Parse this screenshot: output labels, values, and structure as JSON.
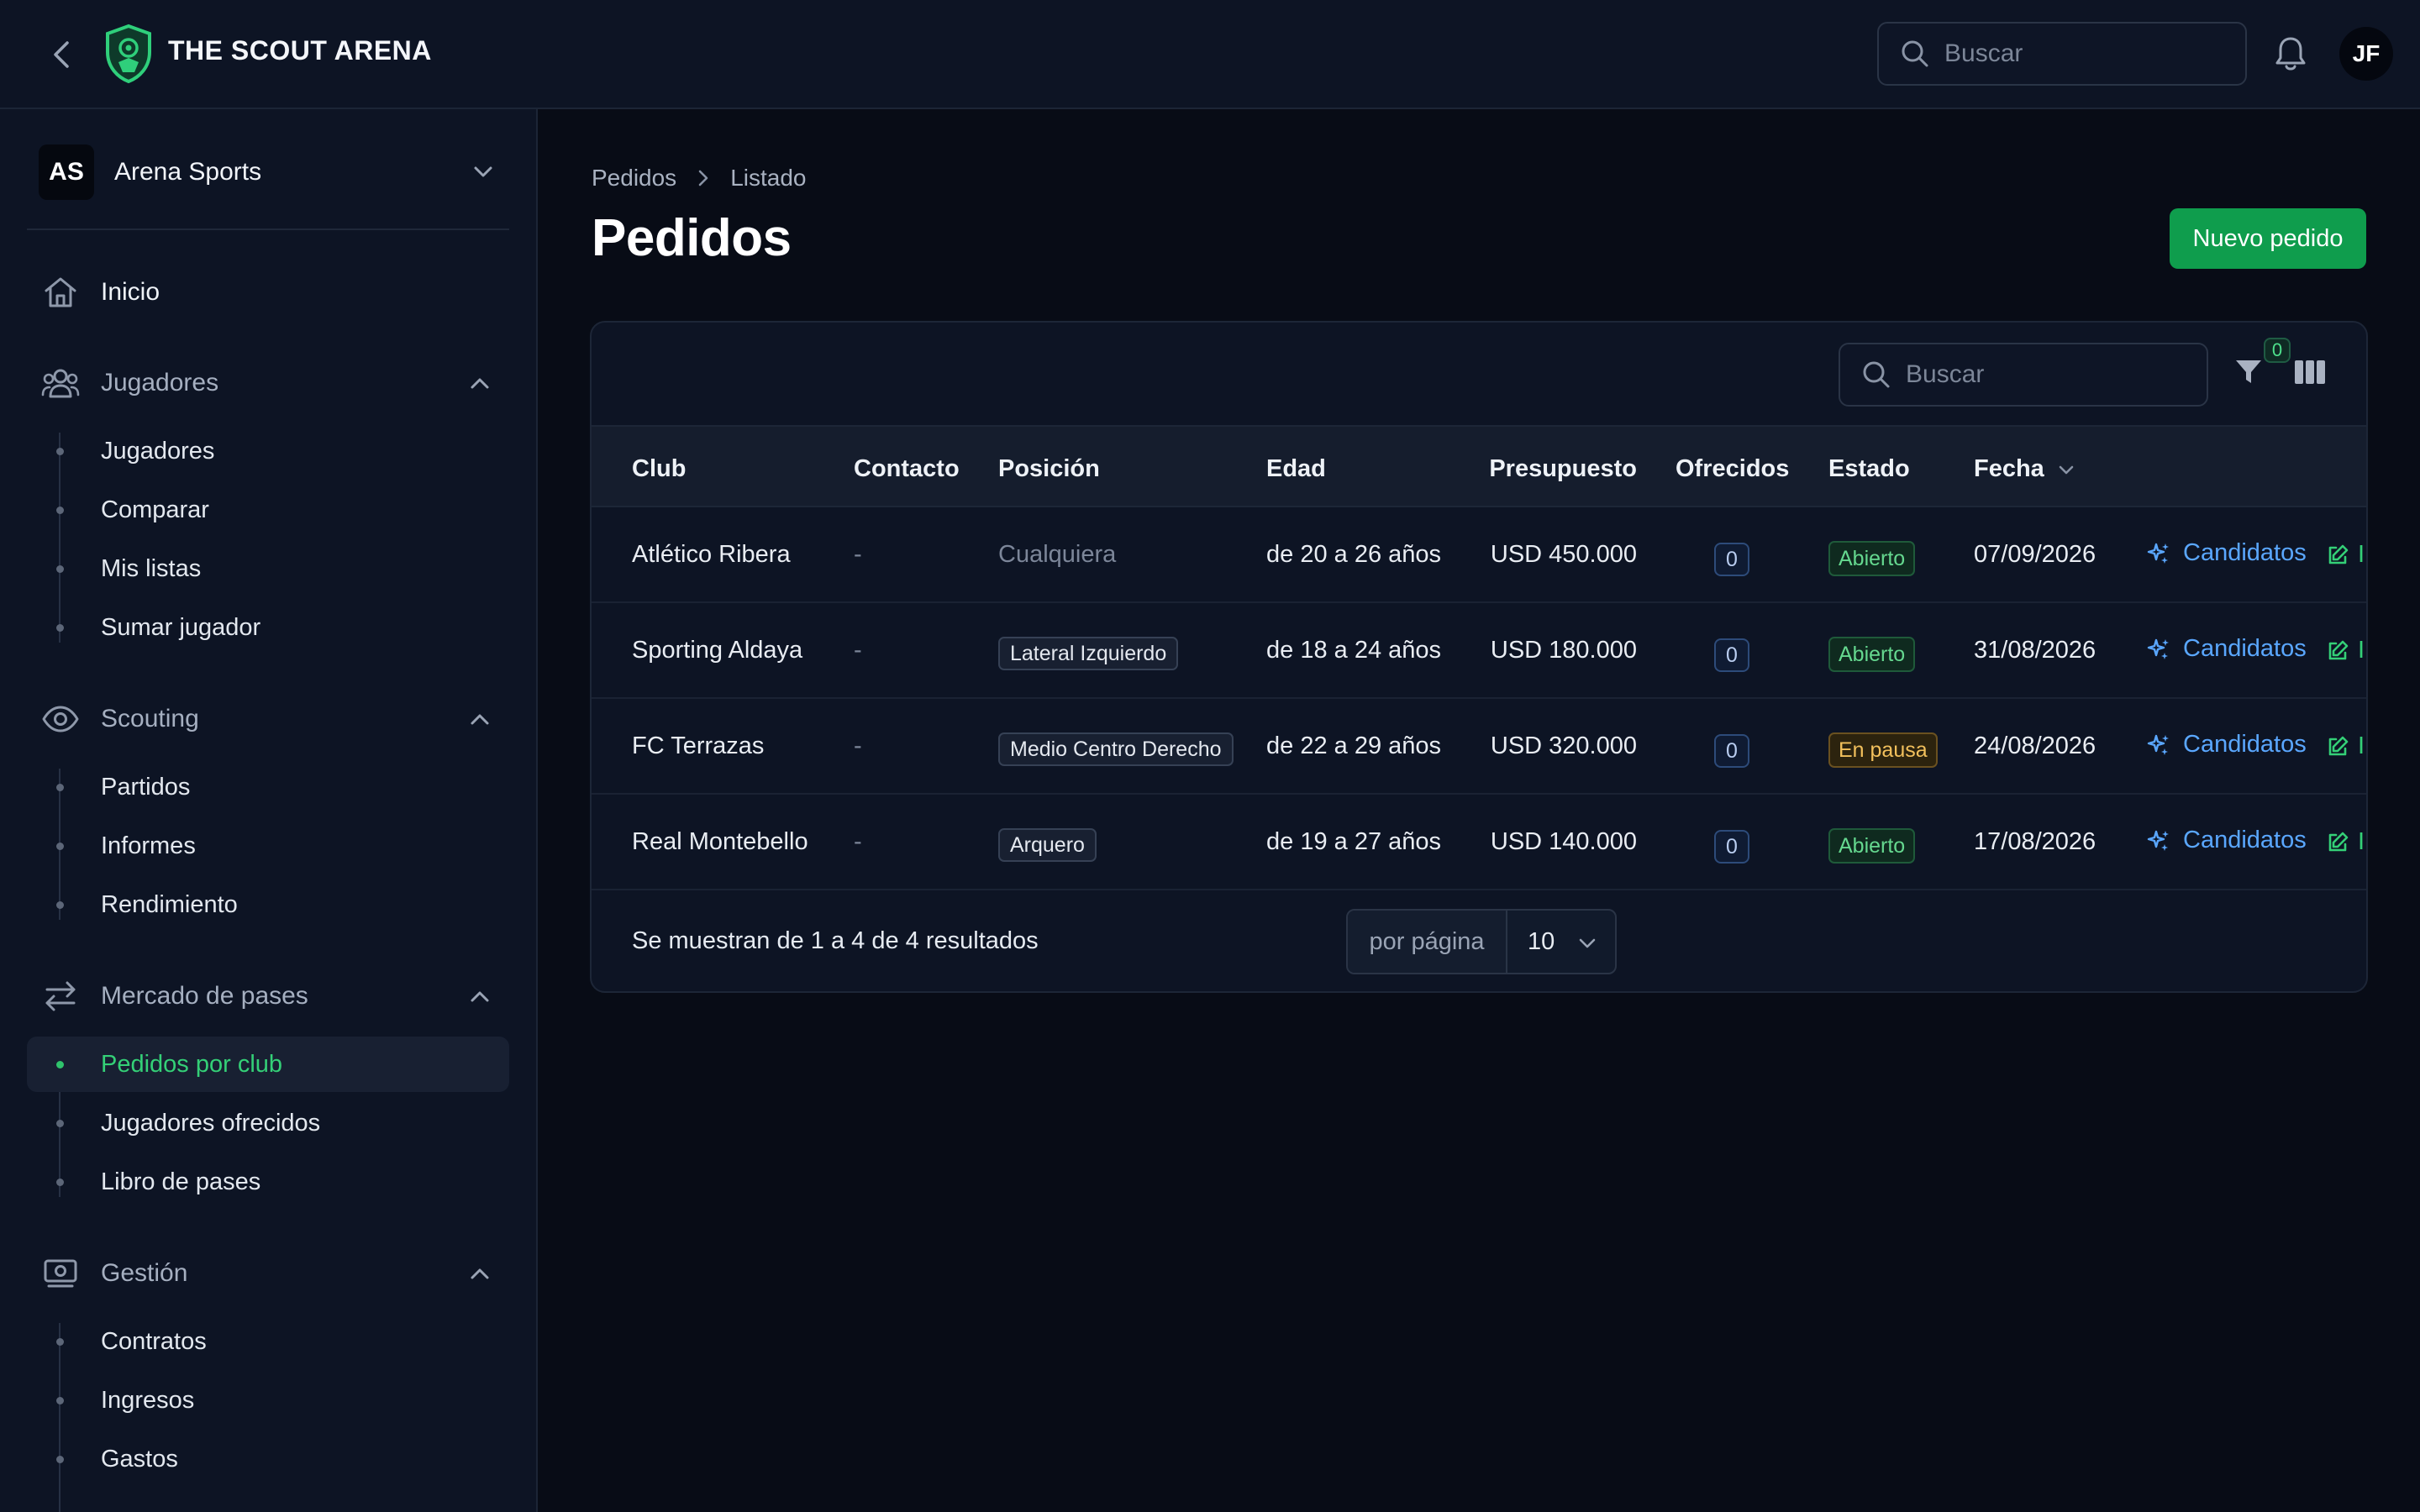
{
  "app": {
    "brand": "THE SCOUT ARENA",
    "user_initials": "JF",
    "accent": "#22c55e"
  },
  "topbar": {
    "search_placeholder": "Buscar"
  },
  "sidebar": {
    "org": {
      "initials": "AS",
      "name": "Arena Sports"
    },
    "inicio": "Inicio",
    "sections": {
      "jugadores": {
        "label": "Jugadores",
        "items": [
          "Jugadores",
          "Comparar",
          "Mis listas",
          "Sumar jugador"
        ]
      },
      "scouting": {
        "label": "Scouting",
        "items": [
          "Partidos",
          "Informes",
          "Rendimiento"
        ]
      },
      "mercado": {
        "label": "Mercado de pases",
        "items": [
          "Pedidos por club",
          "Jugadores ofrecidos",
          "Libro de pases"
        ],
        "active_index": 0
      },
      "gestion": {
        "label": "Gestión",
        "items": [
          "Contratos",
          "Ingresos",
          "Gastos"
        ]
      }
    }
  },
  "breadcrumb": {
    "root": "Pedidos",
    "current": "Listado"
  },
  "page": {
    "title": "Pedidos",
    "new_button": "Nuevo pedido"
  },
  "table": {
    "search_placeholder": "Buscar",
    "filter_count": "0",
    "columns": {
      "club": "Club",
      "contacto": "Contacto",
      "posicion": "Posición",
      "edad": "Edad",
      "presupuesto": "Presupuesto",
      "ofrecidos": "Ofrecidos",
      "estado": "Estado",
      "fecha": "Fecha"
    },
    "rows": [
      {
        "club": "Atlético Ribera",
        "contacto": "-",
        "posicion": "Cualquiera",
        "edad": "de 20 a 26 años",
        "presupuesto": "USD 450.000",
        "ofrecidos": "0",
        "estado": "Abierto",
        "fecha": "07/09/2026",
        "candidatos": "Candidatos"
      },
      {
        "club": "Sporting Aldaya",
        "contacto": "-",
        "posicion": "Lateral Izquierdo",
        "edad": "de 18 a 24 años",
        "presupuesto": "USD 180.000",
        "ofrecidos": "0",
        "estado": "Abierto",
        "fecha": "31/08/2026",
        "candidatos": "Candidatos"
      },
      {
        "club": "FC Terrazas",
        "contacto": "-",
        "posicion": "Medio Centro Derecho",
        "edad": "de 22 a 29 años",
        "presupuesto": "USD 320.000",
        "ofrecidos": "0",
        "estado": "En pausa",
        "fecha": "24/08/2026",
        "candidatos": "Candidatos"
      },
      {
        "club": "Real Montebello",
        "contacto": "-",
        "posicion": "Arquero",
        "edad": "de 19 a 27 años",
        "presupuesto": "USD 140.000",
        "ofrecidos": "0",
        "estado": "Abierto",
        "fecha": "17/08/2026",
        "candidatos": "Candidatos"
      }
    ],
    "edit_label": "I",
    "footer": {
      "summary": "Se muestran de 1 a 4 de 4 resultados",
      "per_page_label": "por página",
      "per_page_value": "10"
    }
  }
}
